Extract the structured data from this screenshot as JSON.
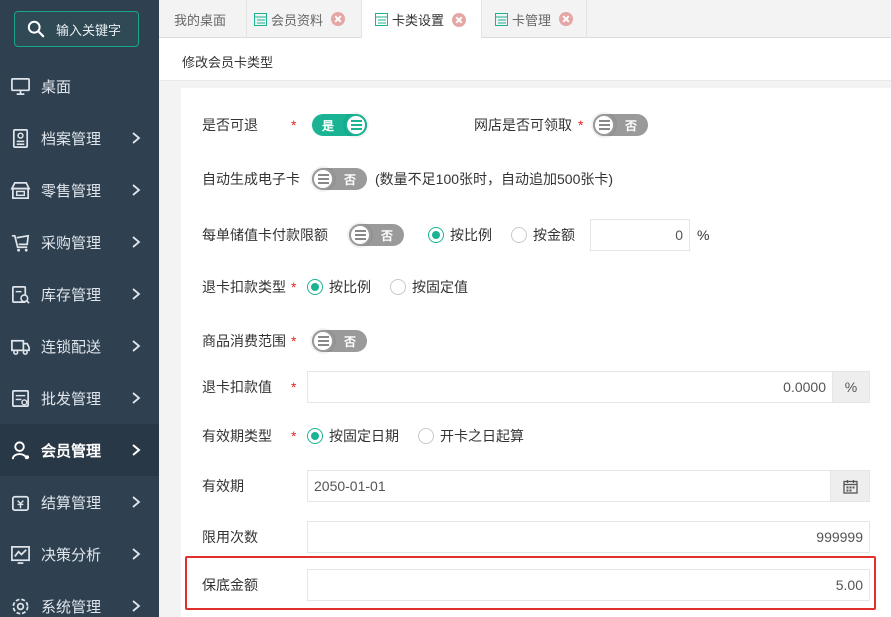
{
  "sidebar": {
    "search_placeholder": "输入关键字",
    "items": [
      {
        "label": "桌面",
        "icon": "monitor-icon"
      },
      {
        "label": "档案管理",
        "icon": "archive-icon"
      },
      {
        "label": "零售管理",
        "icon": "store-icon"
      },
      {
        "label": "采购管理",
        "icon": "cart-icon"
      },
      {
        "label": "库存管理",
        "icon": "inventory-icon"
      },
      {
        "label": "连锁配送",
        "icon": "truck-icon"
      },
      {
        "label": "批发管理",
        "icon": "wholesale-icon"
      },
      {
        "label": "会员管理",
        "icon": "member-icon",
        "active": true
      },
      {
        "label": "结算管理",
        "icon": "settlement-icon"
      },
      {
        "label": "决策分析",
        "icon": "analysis-icon"
      },
      {
        "label": "系统管理",
        "icon": "settings-icon"
      }
    ]
  },
  "tabs": [
    {
      "label": "我的桌面",
      "icon": false,
      "closable": false
    },
    {
      "label": "会员资料",
      "icon": true,
      "closable": true
    },
    {
      "label": "卡类设置",
      "icon": true,
      "closable": true,
      "active": true
    },
    {
      "label": "卡管理",
      "icon": true,
      "closable": true
    }
  ],
  "panel_title": "修改会员卡类型",
  "form": {
    "refundable": {
      "label": "是否可退",
      "value": "是"
    },
    "online_claim": {
      "label": "网店是否可领取",
      "value": "否"
    },
    "auto_generate": {
      "label": "自动生成电子卡",
      "value": "否",
      "note": "(数量不足100张时，自动追加500张卡)"
    },
    "stored_limit": {
      "label": "每单储值卡付款限额",
      "value": "否",
      "option_ratio": "按比例",
      "option_amount": "按金额",
      "input_value": "0",
      "unit": "%"
    },
    "refund_deduct_type": {
      "label": "退卡扣款类型",
      "option_ratio": "按比例",
      "option_fixed": "按固定值"
    },
    "consume_scope": {
      "label": "商品消费范围",
      "value": "否"
    },
    "refund_deduct_value": {
      "label": "退卡扣款值",
      "value": "0.0000",
      "unit": "%"
    },
    "validity_type": {
      "label": "有效期类型",
      "option_fixed_date": "按固定日期",
      "option_from_open": "开卡之日起算"
    },
    "validity": {
      "label": "有效期",
      "value": "2050-01-01"
    },
    "usage_limit": {
      "label": "限用次数",
      "value": "999999"
    },
    "min_amount": {
      "label": "保底金额",
      "value": "5.00"
    }
  },
  "colors": {
    "accent": "#1ab394",
    "sidebar": "#2f4050",
    "highlight": "#e0302d"
  }
}
